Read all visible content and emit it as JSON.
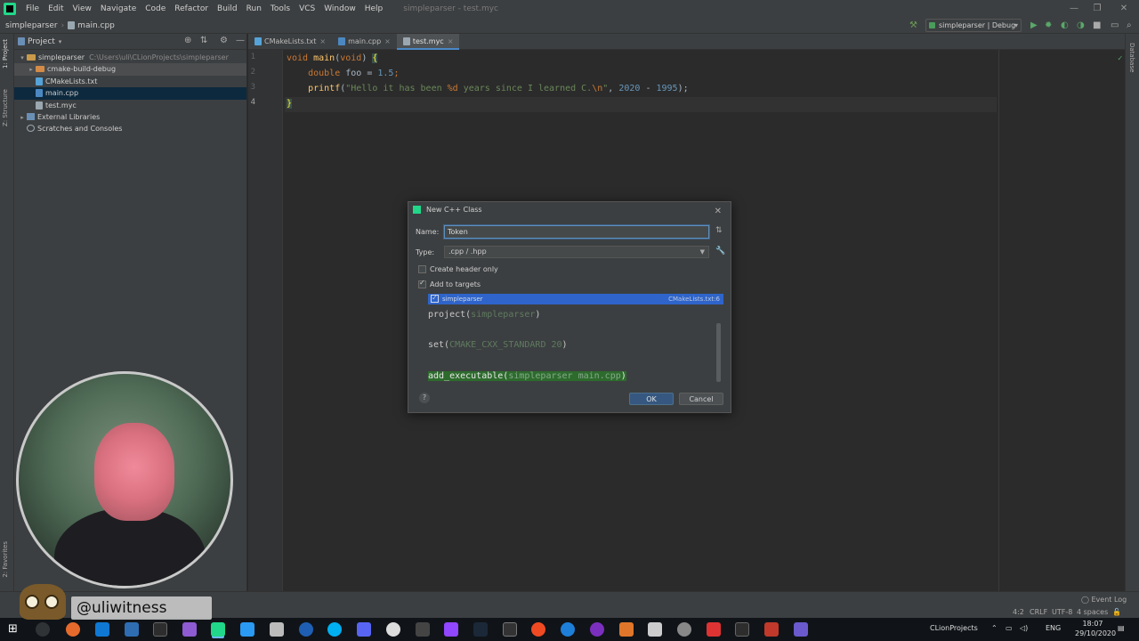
{
  "menubar": {
    "items": [
      "File",
      "Edit",
      "View",
      "Navigate",
      "Code",
      "Refactor",
      "Build",
      "Run",
      "Tools",
      "VCS",
      "Window",
      "Help"
    ],
    "window_title": "simpleparser - test.myc"
  },
  "navbar": {
    "project": "simpleparser",
    "file": "main.cpp",
    "run_config": "simpleparser | Debug"
  },
  "left_strip": {
    "project_label": "1: Project",
    "structure_label": "Z: Structure",
    "favorites_label": "2: Favorites"
  },
  "project_panel": {
    "title": "Project",
    "tree": [
      {
        "label": "simpleparser",
        "path": "C:\\Users\\uli\\CLionProjects\\simpleparser"
      },
      {
        "label": "cmake-build-debug"
      },
      {
        "label": "CMakeLists.txt"
      },
      {
        "label": "main.cpp"
      },
      {
        "label": "test.myc"
      },
      {
        "label": "External Libraries"
      },
      {
        "label": "Scratches and Consoles"
      }
    ]
  },
  "editor": {
    "tabs": [
      "CMakeLists.txt",
      "main.cpp",
      "test.myc"
    ],
    "line_numbers": [
      "1",
      "2",
      "3",
      "4"
    ],
    "code": {
      "l1_kw": "void",
      "l1_fn": "main",
      "l1_open": "(",
      "l1_kw2": "void",
      "l1_close": ") ",
      "l1_brace": "{",
      "l2_kw": "double",
      "l2_rest": " foo = ",
      "l2_num": "1.5",
      "l2_end": ";",
      "l3_fn": "printf",
      "l3_open": "(",
      "l3_str1": "\"Hello it has been ",
      "l3_fmt": "%d",
      "l3_str2": " years since I learned C.",
      "l3_esc": "\\n",
      "l3_str3": "\"",
      "l3_sep1": ", ",
      "l3_num1": "2020",
      "l3_minus": " - ",
      "l3_num2": "1995",
      "l3_end": ");",
      "l4_brace": "}"
    }
  },
  "dialog": {
    "title": "New C++ Class",
    "name_label": "Name:",
    "name_value": "Token",
    "type_label": "Type:",
    "type_value": ".cpp / .hpp",
    "create_header_only": "Create header only",
    "add_to_targets": "Add to targets",
    "target_name": "simpleparser",
    "target_file": "CMakeLists.txt:6",
    "preview": {
      "l1_fn": "project(",
      "l1_arg": "simpleparser",
      "l1_end": ")",
      "l2_fn": "set(",
      "l2_arg": "CMAKE_CXX_STANDARD 20",
      "l2_end": ")",
      "l3_fn": "add_executable(",
      "l3_arg": "simpleparser main.cpp",
      "l3_end": ")"
    },
    "help": "?",
    "ok": "OK",
    "cancel": "Cancel"
  },
  "statusbar": {
    "event_log": "Event Log",
    "position": "4:2",
    "line_sep": "CRLF",
    "encoding": "UTF-8",
    "indent": "4 spaces"
  },
  "overlay": {
    "handle": "@uliwitness"
  },
  "taskbar": {
    "folder": "CLionProjects",
    "lang": "ENG",
    "time": "18:07",
    "date": "29/10/2020"
  }
}
